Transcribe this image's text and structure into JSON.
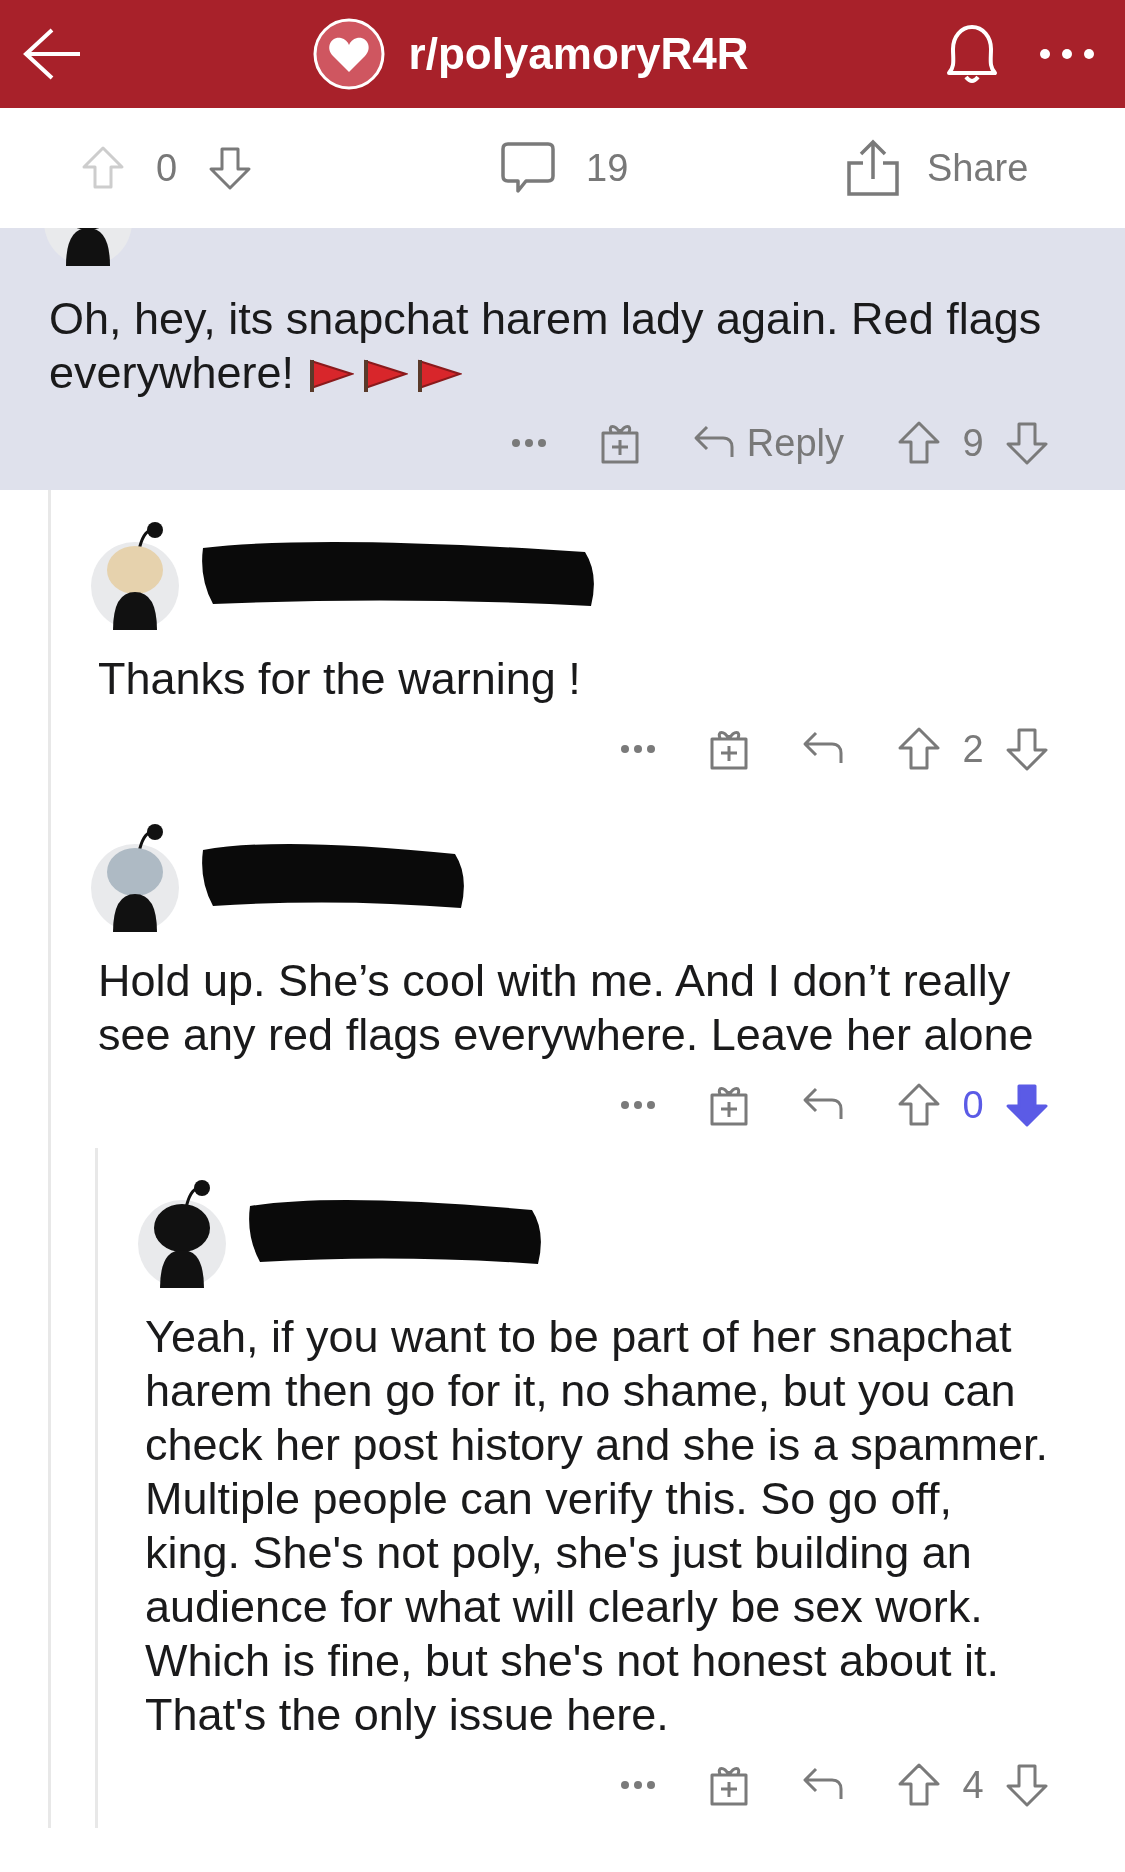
{
  "header": {
    "title": "r/polyamoryR4R"
  },
  "post_bar": {
    "score": "0",
    "comments": "19",
    "share": "Share"
  },
  "comments": [
    {
      "header_cut": true,
      "highlighted": true,
      "body": [
        "Oh, hey, its snapchat harem lady again. Red flags",
        "everywhere!"
      ],
      "trailing_emoji": [
        {
          "kind": "flag"
        },
        {
          "kind": "flag"
        },
        {
          "kind": "flag"
        }
      ],
      "reply_label": "Reply",
      "score": "9",
      "downvoted": false,
      "children": [
        {
          "header_cut": false,
          "author_redacted": true,
          "body": [
            "Thanks for the warning !"
          ],
          "score": "2",
          "downvoted": false
        },
        {
          "header_cut": false,
          "author_redacted": true,
          "body": [
            "Hold up. She’s cool with me. And I don’t really",
            "see any red flags everywhere. Leave her alone"
          ],
          "score": "0",
          "downvoted": true,
          "children": [
            {
              "header_cut": false,
              "author_redacted": true,
              "body": [
                "Yeah, if you want to be part of her snapchat",
                "harem then go for it, no shame, but you can",
                "check her post history and she is a spammer.",
                "Multiple people can verify this. So go off,",
                "king. She's not poly, she's just building an",
                "audience for what will clearly be sex work.",
                "Which is fine, but she's not honest about it.",
                "That's the only issue here."
              ],
              "score": "4",
              "downvoted": false
            }
          ]
        }
      ]
    }
  ]
}
